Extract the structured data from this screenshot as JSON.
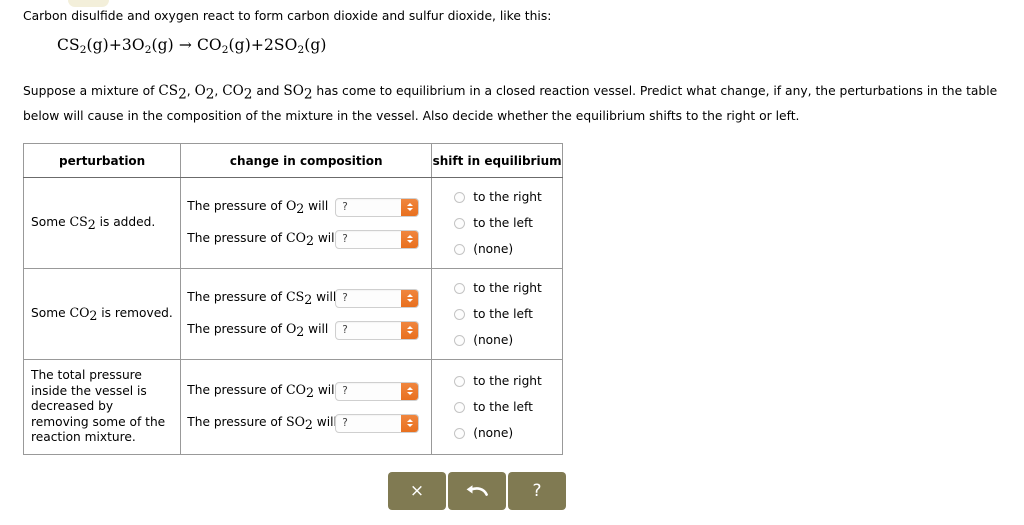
{
  "intro": {
    "line": "Carbon disulfide and oxygen react to form carbon dioxide and sulfur dioxide, like this:"
  },
  "equation": {
    "text": "CS2(g)+3O2(g) → CO2(g)+2SO2(g)",
    "reactant_1": "CS",
    "reactant_1_sub": "2",
    "reactant_1_state": "(g)",
    "plus_1": "+",
    "reactant_2_coeff": "3",
    "reactant_2": "O",
    "reactant_2_sub": "2",
    "reactant_2_state": "(g)",
    "arrow": "→",
    "product_1": "CO",
    "product_1_sub": "2",
    "product_1_state": "(g)",
    "plus_2": "+",
    "product_2_coeff": "2",
    "product_2": "SO",
    "product_2_sub": "2",
    "product_2_state": "(g)"
  },
  "prompt": {
    "part_1": "Suppose a mixture of ",
    "sp1": "CS",
    "sp1_sub": "2",
    "sep1": ", ",
    "sp2": "O",
    "sp2_sub": "2",
    "sep2": ", ",
    "sp3": "CO",
    "sp3_sub": "2",
    "sep3": " and ",
    "sp4": "SO",
    "sp4_sub": "2",
    "part_2": " has come to equilibrium in a closed reaction vessel. Predict what change, if any, the perturbations in the table below will cause in the composition of the mixture in the vessel. Also decide whether the equilibrium shifts to the right or left."
  },
  "table": {
    "headers": {
      "perturbation": "perturbation",
      "change": "change in composition",
      "shift": "shift in equilibrium"
    },
    "rows": [
      {
        "perturbation_prefix": "Some ",
        "perturbation_species": "CS",
        "perturbation_species_sub": "2",
        "perturbation_suffix": " is added.",
        "changes": [
          {
            "label_prefix": "The pressure of ",
            "species": "O",
            "species_sub": "2",
            "label_suffix": " will",
            "value": "?"
          },
          {
            "label_prefix": "The pressure of ",
            "species": "CO",
            "species_sub": "2",
            "label_suffix": " will",
            "value": "?"
          }
        ],
        "shift_options": [
          "to the right",
          "to the left",
          "(none)"
        ]
      },
      {
        "perturbation_prefix": "Some ",
        "perturbation_species": "CO",
        "perturbation_species_sub": "2",
        "perturbation_suffix": " is removed.",
        "changes": [
          {
            "label_prefix": "The pressure of ",
            "species": "CS",
            "species_sub": "2",
            "label_suffix": " will",
            "value": "?"
          },
          {
            "label_prefix": "The pressure of ",
            "species": "O",
            "species_sub": "2",
            "label_suffix": " will",
            "value": "?"
          }
        ],
        "shift_options": [
          "to the right",
          "to the left",
          "(none)"
        ]
      },
      {
        "perturbation_text": "The total pressure inside the vessel is decreased by removing some of the reaction mixture.",
        "changes": [
          {
            "label_prefix": "The pressure of ",
            "species": "CO",
            "species_sub": "2",
            "label_suffix": " will",
            "value": "?"
          },
          {
            "label_prefix": "The pressure of ",
            "species": "SO",
            "species_sub": "2",
            "label_suffix": " will",
            "value": "?"
          }
        ],
        "shift_options": [
          "to the right",
          "to the left",
          "(none)"
        ]
      }
    ]
  },
  "toolbar": {
    "clear_label": "×",
    "undo_label": "undo-arrow",
    "help_label": "?"
  },
  "colors": {
    "accent_orange": "#e8701f",
    "toolbar_brown": "#807a52",
    "tab_cream": "#f3efda",
    "table_border": "#999999"
  }
}
